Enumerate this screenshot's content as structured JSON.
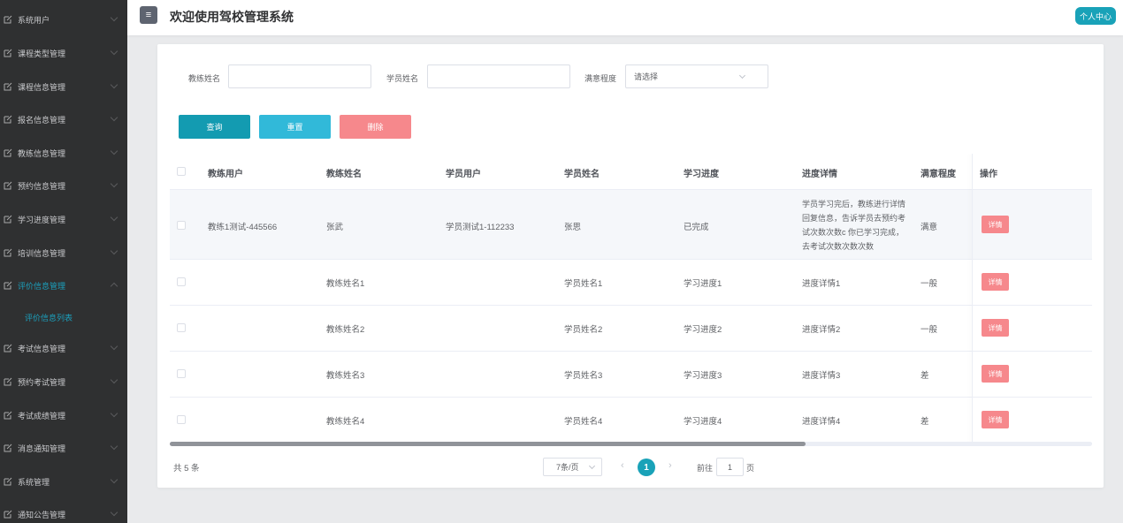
{
  "sidebar": {
    "items": [
      {
        "label": "系统用户",
        "icon": "edit-icon"
      },
      {
        "label": "课程类型管理",
        "icon": "edit-icon"
      },
      {
        "label": "课程信息管理",
        "icon": "edit-icon"
      },
      {
        "label": "报名信息管理",
        "icon": "edit-icon"
      },
      {
        "label": "教练信息管理",
        "icon": "edit-icon"
      },
      {
        "label": "预约信息管理",
        "icon": "edit-icon"
      },
      {
        "label": "学习进度管理",
        "icon": "edit-icon"
      },
      {
        "label": "培训信息管理",
        "icon": "edit-icon"
      },
      {
        "label": "评价信息管理",
        "icon": "edit-icon",
        "active": true
      },
      {
        "label": "考试信息管理",
        "icon": "edit-icon"
      },
      {
        "label": "预约考试管理",
        "icon": "edit-icon"
      },
      {
        "label": "考试成绩管理",
        "icon": "edit-icon"
      },
      {
        "label": "消息通知管理",
        "icon": "edit-icon"
      },
      {
        "label": "系统管理",
        "icon": "edit-icon"
      },
      {
        "label": "通知公告管理",
        "icon": "edit-icon"
      }
    ],
    "submenu_active": "评价信息列表",
    "accent_color": "#1ba0bd"
  },
  "header": {
    "toggle_icon": "≡",
    "title": "欢迎使用驾校管理系统",
    "profile_label": "个人中心"
  },
  "filters": {
    "coach_name_label": "教练姓名",
    "student_name_label": "学员姓名",
    "satisfaction_label": "满意程度",
    "satisfaction_value": "请选择"
  },
  "actions": {
    "query": "查询",
    "reset": "重置",
    "delete": "删除"
  },
  "table": {
    "headers": [
      "教练用户",
      "教练姓名",
      "学员用户",
      "学员姓名",
      "学习进度",
      "进度详情",
      "满意程度",
      "操作"
    ],
    "rows": [
      {
        "coach_user": "教练1测试-445566",
        "coach_name": "张武",
        "student_user": "学员测试1-112233",
        "student_name": "张思",
        "progress": "已完成",
        "detail": "学员学习完后，教练进行详情回复信息，告诉学员去预约考试次数次数c 你已学习完成，去考试次数次数次数",
        "satisfaction": "满意",
        "op": "详情"
      },
      {
        "coach_user": "",
        "coach_name": "教练姓名1",
        "student_user": "",
        "student_name": "学员姓名1",
        "progress": "学习进度1",
        "detail": "进度详情1",
        "satisfaction": "一般",
        "op": "详情"
      },
      {
        "coach_user": "",
        "coach_name": "教练姓名2",
        "student_user": "",
        "student_name": "学员姓名2",
        "progress": "学习进度2",
        "detail": "进度详情2",
        "satisfaction": "一般",
        "op": "详情"
      },
      {
        "coach_user": "",
        "coach_name": "教练姓名3",
        "student_user": "",
        "student_name": "学员姓名3",
        "progress": "学习进度3",
        "detail": "进度详情3",
        "satisfaction": "差",
        "op": "详情"
      },
      {
        "coach_user": "",
        "coach_name": "教练姓名4",
        "student_user": "",
        "student_name": "学员姓名4",
        "progress": "学习进度4",
        "detail": "进度详情4",
        "satisfaction": "差",
        "op": "详情"
      }
    ]
  },
  "pagination": {
    "total": "共 5 条",
    "page_size": "7条/页",
    "prev": "‹",
    "next": "›",
    "current": "1",
    "goto_prefix": "前往",
    "goto_value": "1",
    "goto_suffix": "页"
  },
  "colors": {
    "primary": "#19a2b8",
    "query": "#139bb1",
    "reset": "#31b9d9",
    "danger": "#f6888c",
    "sidebar_bg": "#2f3031"
  }
}
